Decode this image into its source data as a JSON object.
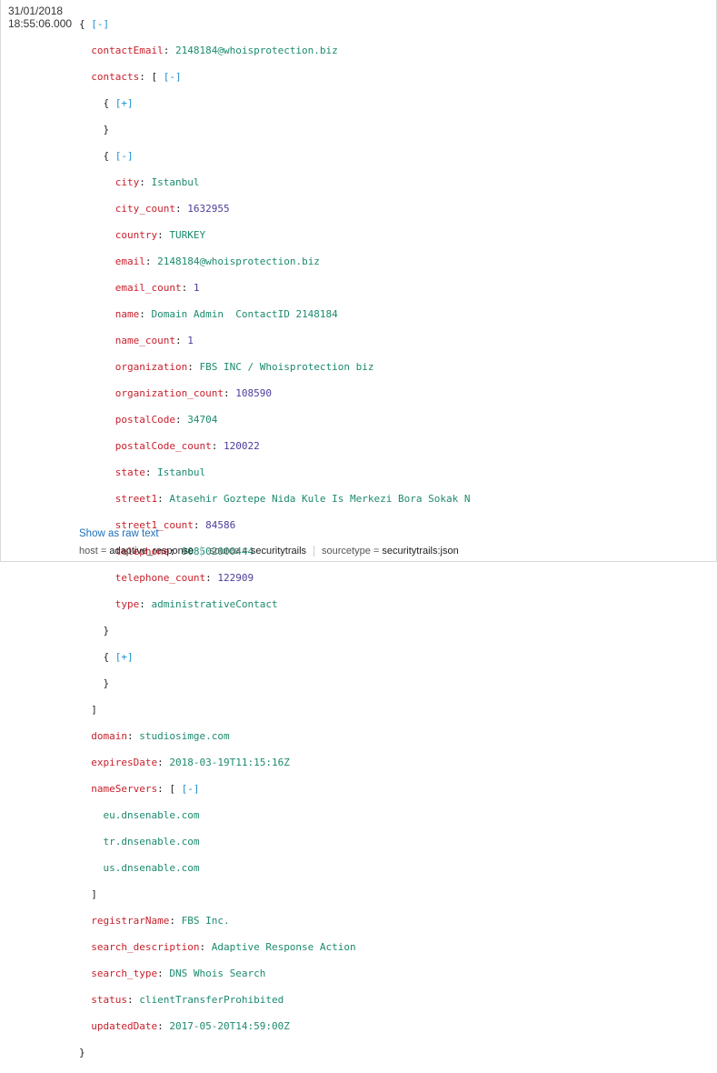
{
  "event": {
    "date": "31/01/2018",
    "time": "18:55:06.000"
  },
  "json": {
    "contactEmail": "2148184@whoisprotection.biz",
    "contact": {
      "city": "Istanbul",
      "city_count": "1632955",
      "country": "TURKEY",
      "email": "2148184@whoisprotection.biz",
      "email_count": "1",
      "name": "Domain Admin  ContactID 2148184",
      "name_count": "1",
      "organization": "FBS INC / Whoisprotection biz",
      "organization_count": "108590",
      "postalCode": "34704",
      "postalCode_count": "120022",
      "state": "Istanbul",
      "street1": "Atasehir Goztepe Nida Kule Is Merkezi Bora Sokak N",
      "street1_count": "84586",
      "telephone": "908502000444",
      "telephone_count": "122909",
      "type": "administrativeContact"
    },
    "domain": "studiosimge.com",
    "expiresDate": "2018-03-19T11:15:16Z",
    "nameServers": [
      "eu.dnsenable.com",
      "tr.dnsenable.com",
      "us.dnsenable.com"
    ],
    "registrarName": "FBS Inc.",
    "search_description": "Adaptive Response Action",
    "search_type": "DNS Whois Search",
    "status": "clientTransferProhibited",
    "updatedDate": "2017-05-20T14:59:00Z"
  },
  "toggles": {
    "collapse": "[-]",
    "expand": "[+]"
  },
  "show_raw_label": "Show as raw text",
  "fields": [
    {
      "name": "host",
      "value": "adaptive_response"
    },
    {
      "name": "source",
      "value": "securitytrails"
    },
    {
      "name": "sourcetype",
      "value": "securitytrails:json"
    }
  ]
}
